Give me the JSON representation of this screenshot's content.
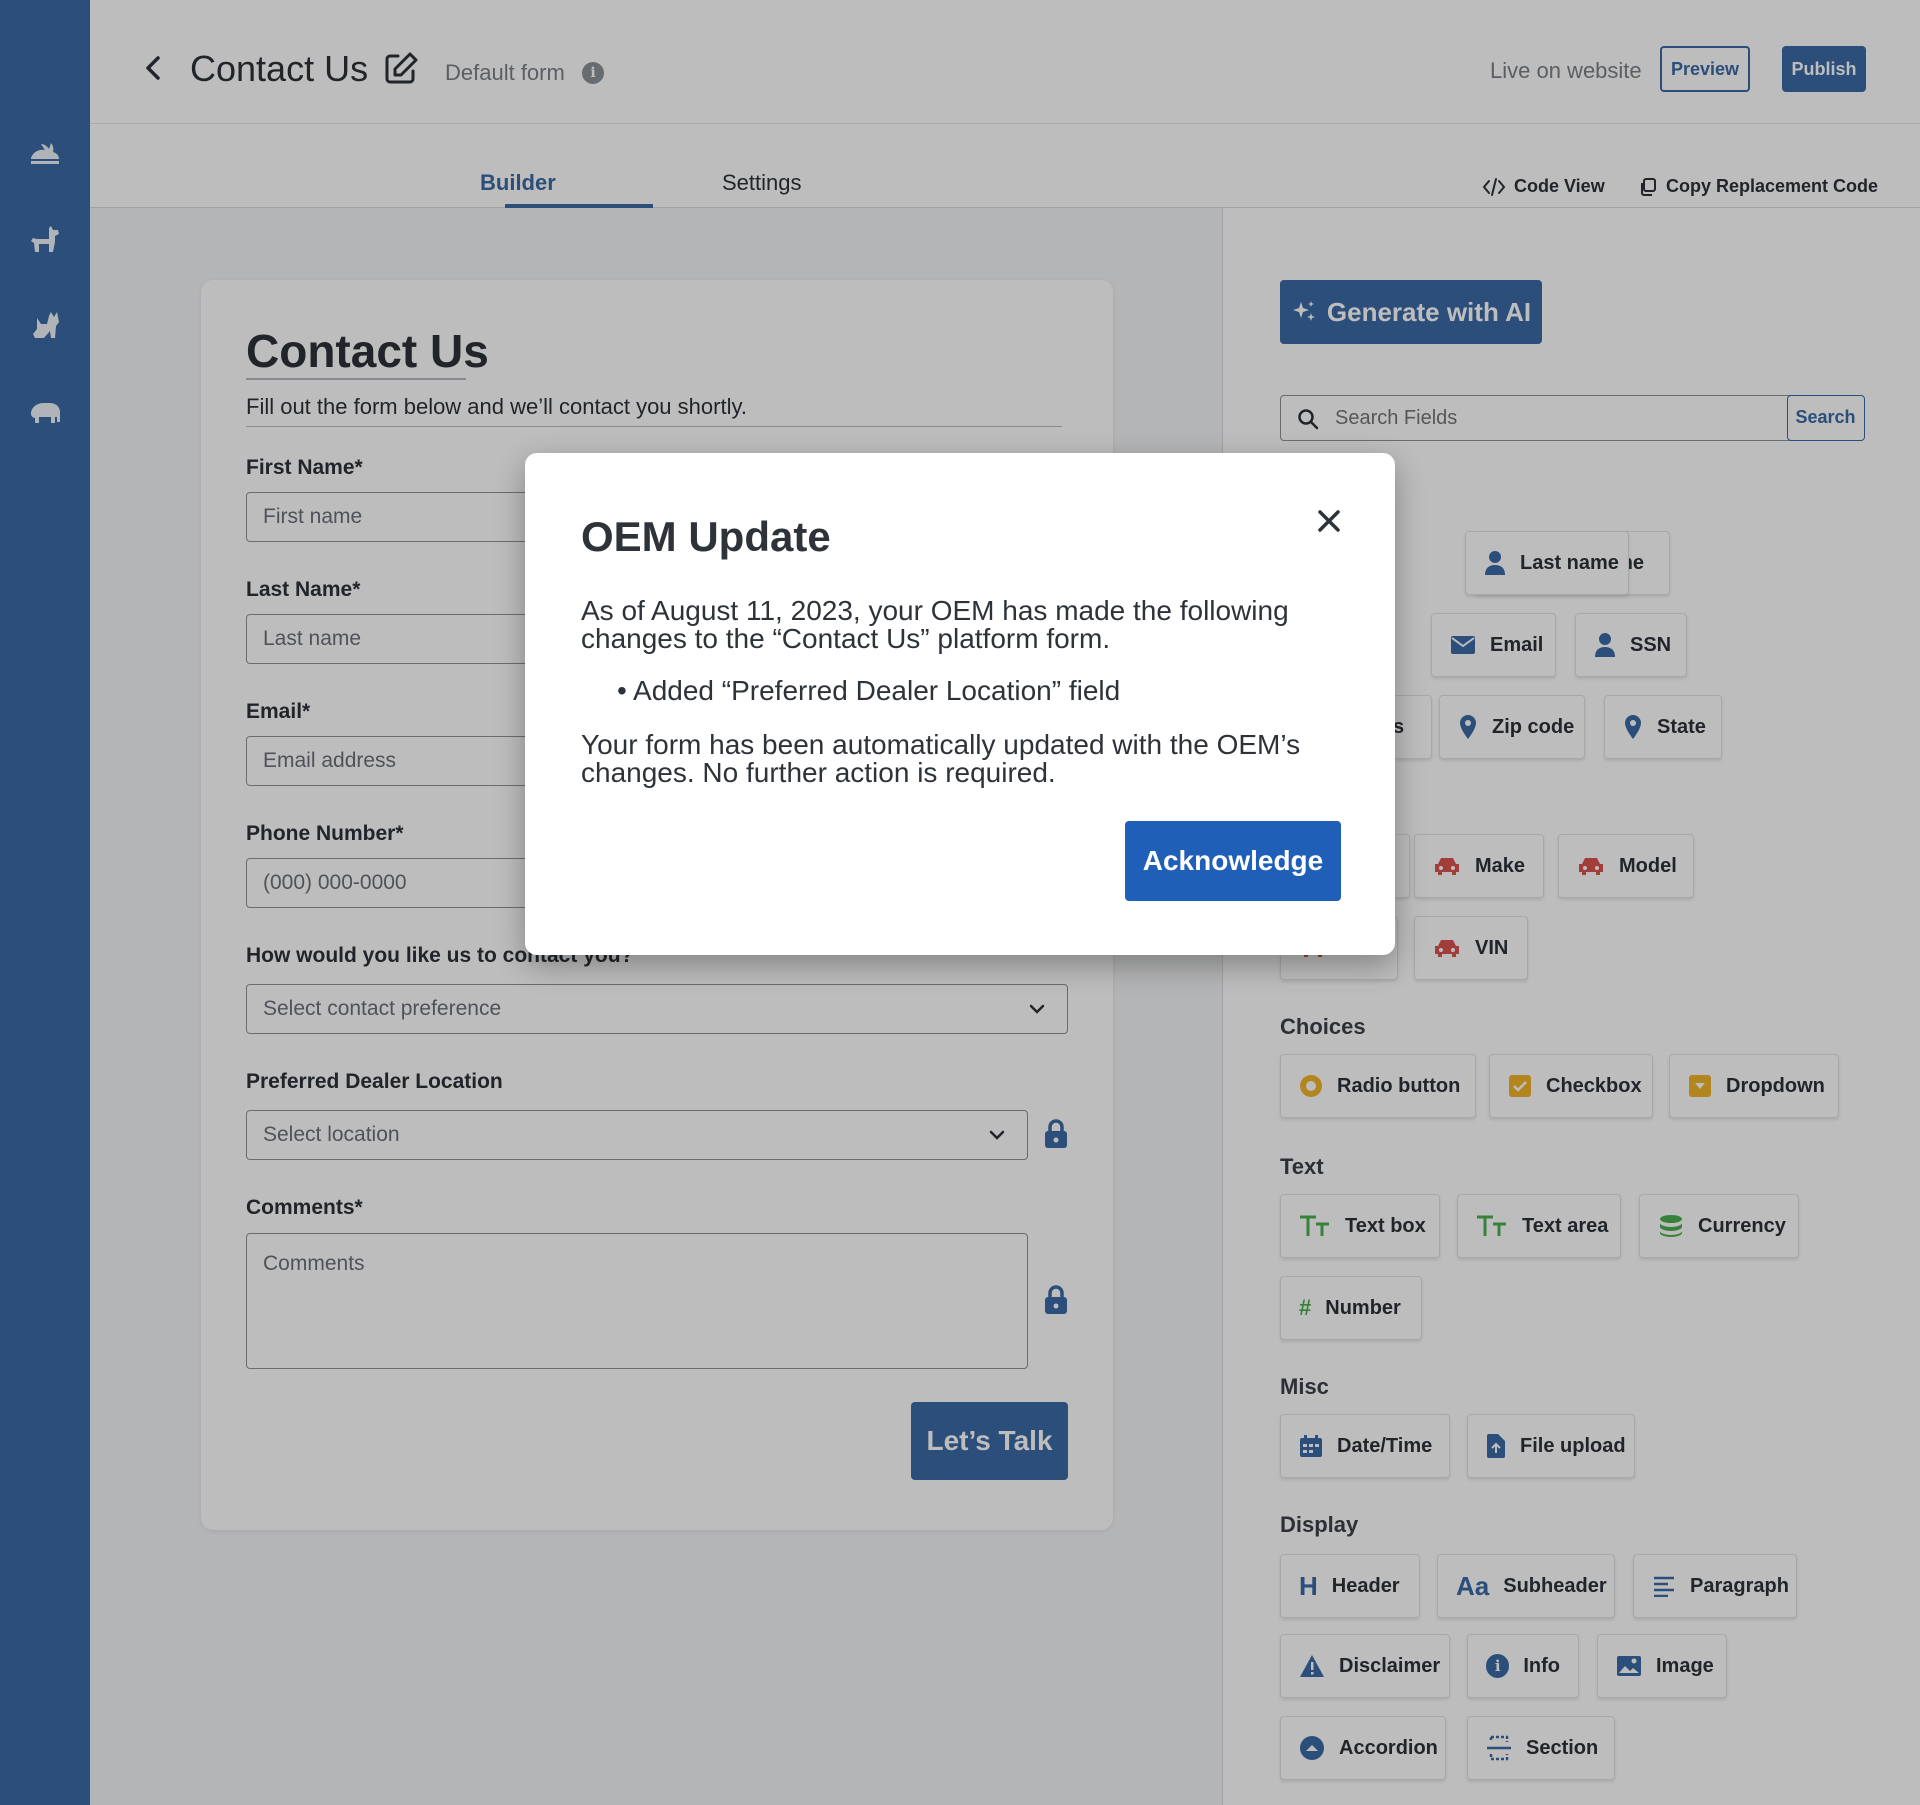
{
  "header": {
    "title": "Contact Us",
    "default_form": "Default form",
    "info_glyph": "i",
    "live_text": "Live on website",
    "preview_label": "Preview",
    "publish_label": "Publish"
  },
  "tabs": {
    "builder": "Builder",
    "settings": "Settings",
    "code_view": "Code View",
    "copy_code": "Copy Replacement Code"
  },
  "form": {
    "title": "Contact Us",
    "subtitle": "Fill out the form below and we’ll contact you shortly.",
    "fields": [
      {
        "label": "First Name*",
        "placeholder": "First name"
      },
      {
        "label": "Last Name*",
        "placeholder": "Last name"
      },
      {
        "label": "Email*",
        "placeholder": "Email address"
      },
      {
        "label": "Phone Number*",
        "placeholder": "(000) 000-0000"
      },
      {
        "label": "How would you like us to contact you?",
        "placeholder": "Select contact preference"
      },
      {
        "label": "Preferred Dealer Location",
        "placeholder": "Select location"
      },
      {
        "label": "Comments*",
        "placeholder": "Comments"
      }
    ],
    "submit_label": "Let’s Talk"
  },
  "panel": {
    "ai_label": "Generate with AI",
    "search_placeholder": "Search Fields",
    "search_button": "Search",
    "row1": [
      "ame",
      "Last name"
    ],
    "row2": [
      "Email",
      "SSN"
    ],
    "row3": [
      "s",
      "Zip code",
      "State"
    ],
    "row4": [
      "Make",
      "Model"
    ],
    "row5": [
      "VIN"
    ],
    "sections": {
      "choices": "Choices",
      "text": "Text",
      "misc": "Misc",
      "display": "Display"
    },
    "choices": [
      "Radio button",
      "Checkbox",
      "Dropdown"
    ],
    "text_items": [
      "Text box",
      "Text area",
      "Currency",
      "Number"
    ],
    "misc": [
      "Date/Time",
      "File upload"
    ],
    "display": [
      "Header",
      "Subheader",
      "Paragraph",
      "Disclaimer",
      "Info",
      "Image",
      "Accordion",
      "Section"
    ],
    "glyphs": {
      "header": "H",
      "subheader": "Aa",
      "info": "i",
      "number": "#"
    }
  },
  "modal": {
    "title": "OEM Update",
    "line1": "As of August 11, 2023, your OEM has made the following changes to the “Contact Us” platform form.",
    "bullet": "• Added “Preferred Dealer Location” field",
    "line2": "Your form has been automatically updated with the OEM’s changes. No further action is required.",
    "ack_label": "Acknowledge"
  },
  "colors": {
    "brand": "#3b6aa5",
    "ack": "#1f5fb7",
    "text_icon": "#4caf50",
    "choice_icon": "#f0b429",
    "vehicle_icon": "#d9534f"
  }
}
